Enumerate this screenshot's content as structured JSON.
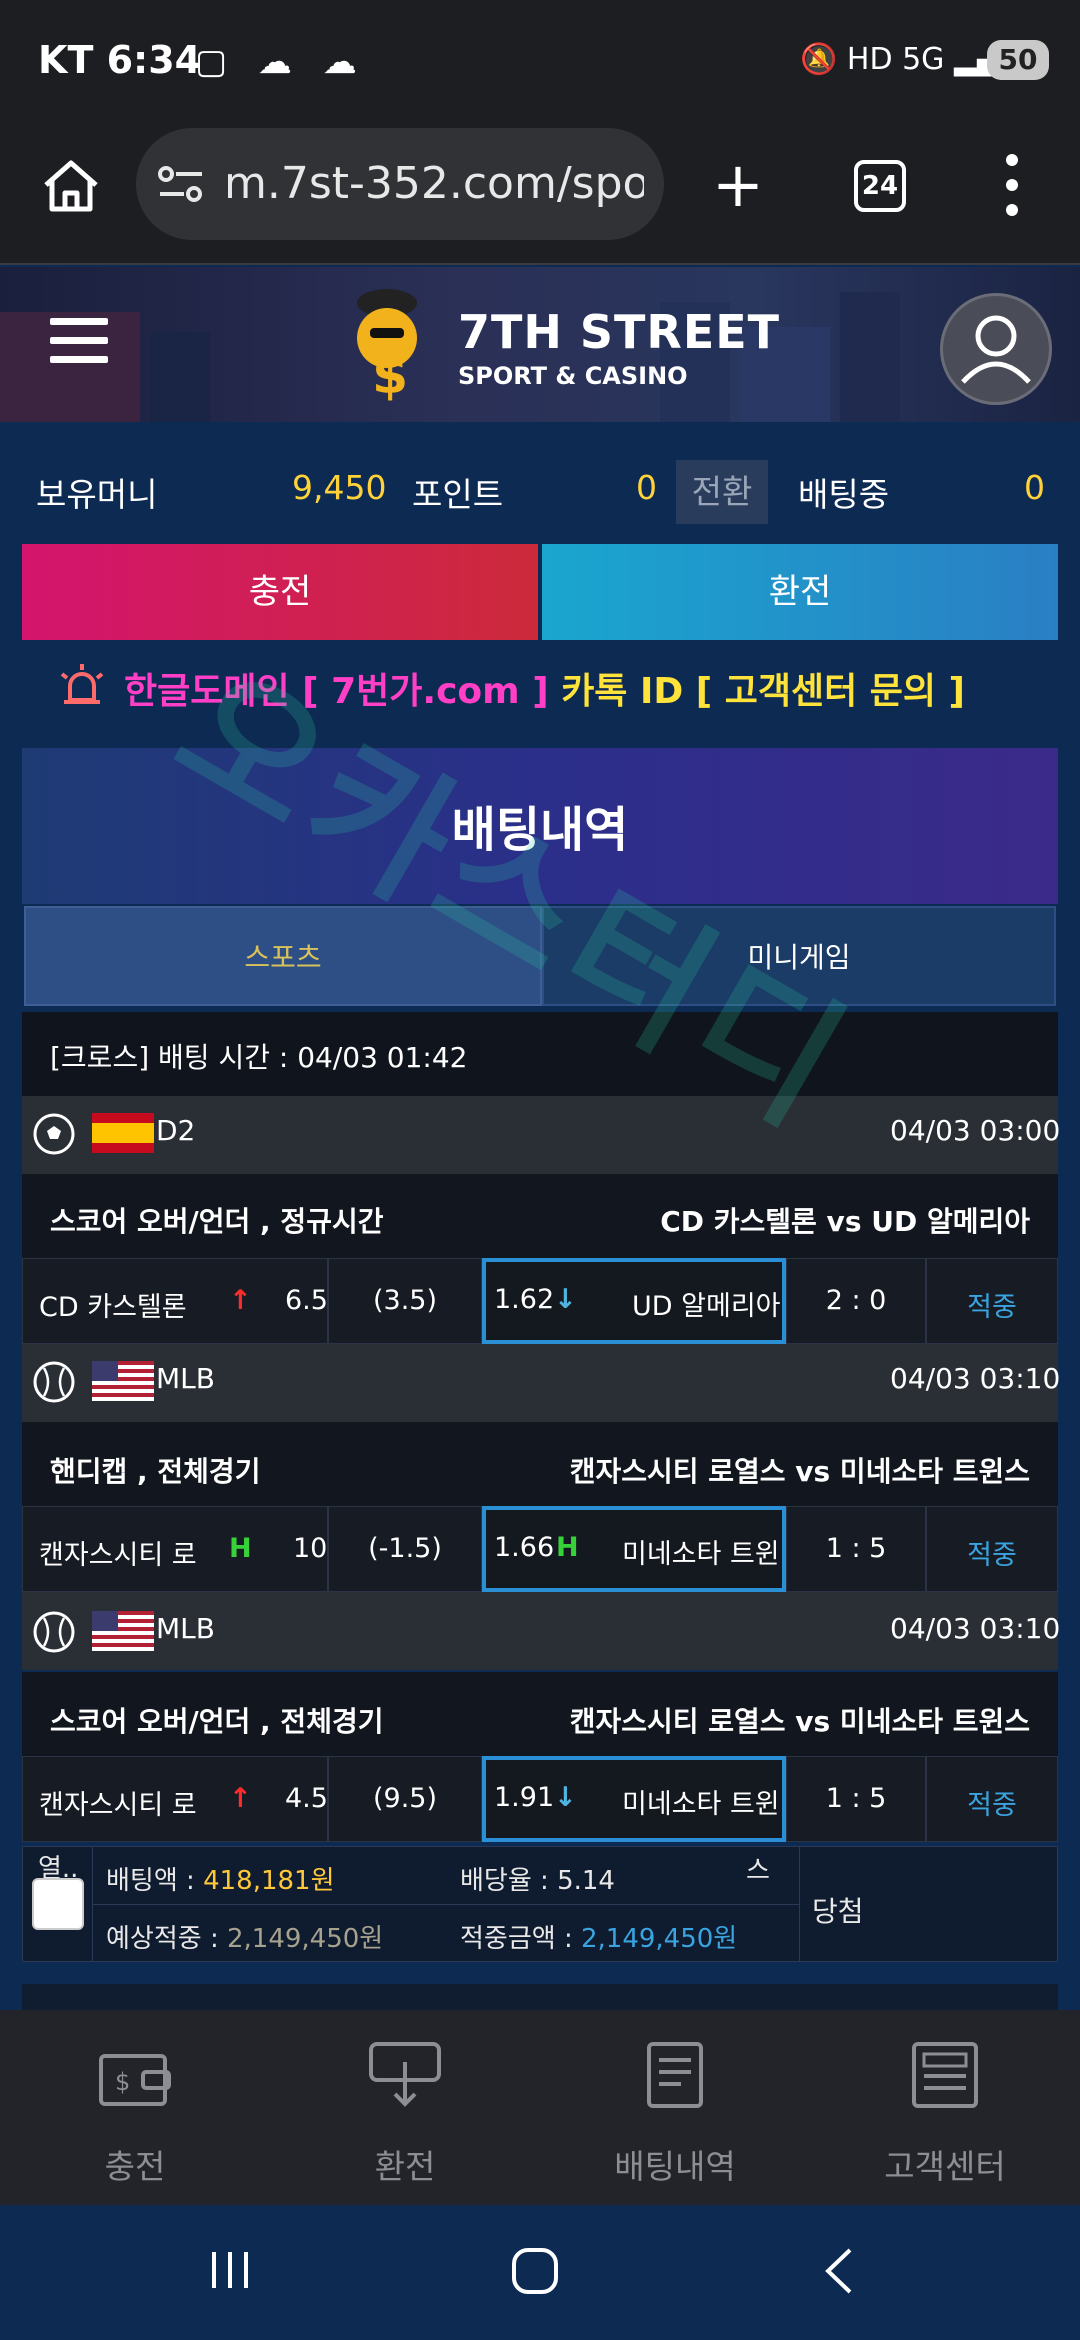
{
  "status_bar": {
    "carrier": "KT",
    "time": "6:34",
    "battery": "50",
    "network": "5G"
  },
  "browser": {
    "url": "m.7st-352.com/sport",
    "tab_count": "24"
  },
  "header": {
    "logo_title": "7TH STREET",
    "logo_subtitle": "SPORT & CASINO"
  },
  "balance": {
    "money_label": "보유머니",
    "money_value": "9,450",
    "point_label": "포인트",
    "point_value": "0",
    "convert_label": "전환",
    "betting_label": "배팅중",
    "betting_value": "0"
  },
  "actions": {
    "charge": "충전",
    "exchange": "환전"
  },
  "notice": {
    "part1": "한글도메인 [ 7번가.com ]",
    "part2": " 카톡 ID [ 고객센터 문의 ]"
  },
  "page_title": "배팅내역",
  "tabs": {
    "sports": "스포츠",
    "mini": "미니게임"
  },
  "bet_slip": {
    "header": "[크로스] 배팅 시간 : 04/03 01:42",
    "games": [
      {
        "league": "D2",
        "time": "04/03 03:00",
        "market": "스코어 오버/언더 , 정규시간",
        "matchup": "CD 카스텔론  vs  UD 알메리아",
        "home": "CD 카스텔론",
        "home_mark": "↑",
        "home_odds": "6.5",
        "line": "(3.5)",
        "away_odds": "1.62",
        "away_mark": "↓",
        "away": "UD 알메리아",
        "score": "2 : 0",
        "result": "적중"
      },
      {
        "league": "MLB",
        "time": "04/03 03:10",
        "market": "핸디캡 , 전체경기",
        "matchup": "캔자스시티 로열스  vs  미네소타 트윈스",
        "home": "캔자스시티 로",
        "home_mark": "H",
        "home_odds": "10",
        "line": "(-1.5)",
        "away_odds": "1.66",
        "away_mark": "H",
        "away": "미네소타 트윈",
        "score": "1 : 5",
        "result": "적중"
      },
      {
        "league": "MLB",
        "time": "04/03 03:10",
        "market": "스코어 오버/언더 , 전체경기",
        "matchup": "캔자스시티 로열스  vs  미네소타 트윈스",
        "home": "캔자스시티 로",
        "home_mark": "↑",
        "home_odds": "4.5",
        "line": "(9.5)",
        "away_odds": "1.91",
        "away_mark": "↓",
        "away": "미네소타 트윈",
        "score": "1 : 5",
        "result": "적중"
      }
    ],
    "summary": {
      "select_label": "열..",
      "bet_amount_label": "배팅액 : ",
      "bet_amount": "418,181원",
      "odds_label": "배당율 : ",
      "odds": "5.14",
      "s_mark": "스",
      "expected_label": "예상적중 : ",
      "expected": "2,149,450원",
      "won_label": "적중금액 : ",
      "won": "2,149,450원",
      "status": "당첨"
    }
  },
  "bottom_nav": {
    "charge": "충전",
    "exchange": "환전",
    "history": "배팅내역",
    "support": "고객센터"
  },
  "watermark": "오카스터디",
  "colors": {
    "accent_yellow": "#ffd23a",
    "accent_blue": "#3aa4e0",
    "hit_green": "#37d13a",
    "up_red": "#ff2a2a"
  }
}
